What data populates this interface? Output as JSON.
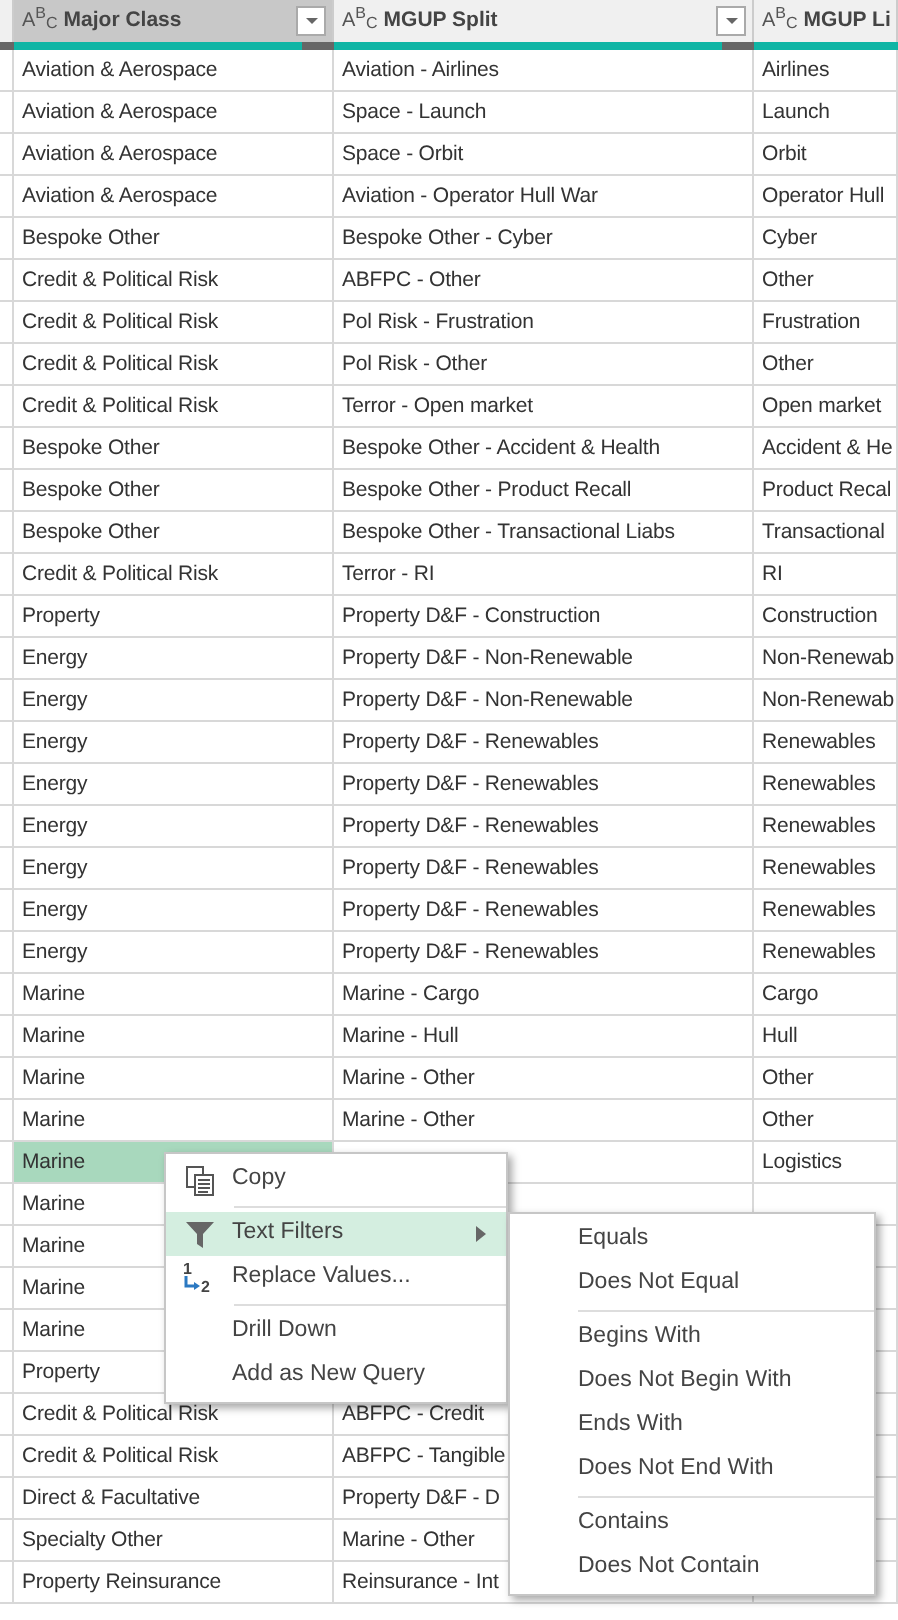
{
  "columns": [
    {
      "type_label": "A$^{B}$$_{C}$",
      "title": "Major Class",
      "selected": true,
      "filter_button": true
    },
    {
      "type_label": "A$^{B}$$_{C}$",
      "title": "MGUP Split",
      "selected": false,
      "filter_button": true
    },
    {
      "type_label": "A$^{B}$$_{C}$",
      "title": "MGUP Li",
      "selected": false,
      "filter_button": false
    }
  ],
  "rows": [
    {
      "selected": false,
      "cells": [
        "Aviation & Aerospace",
        "Aviation - Airlines",
        "Airlines"
      ]
    },
    {
      "selected": false,
      "cells": [
        "Aviation & Aerospace",
        "Space - Launch",
        "Launch"
      ]
    },
    {
      "selected": false,
      "cells": [
        "Aviation & Aerospace",
        "Space - Orbit",
        "Orbit"
      ]
    },
    {
      "selected": false,
      "cells": [
        "Aviation & Aerospace",
        "Aviation - Operator Hull War",
        "Operator Hull"
      ]
    },
    {
      "selected": false,
      "cells": [
        "Bespoke Other",
        "Bespoke Other - Cyber",
        "Cyber"
      ]
    },
    {
      "selected": false,
      "cells": [
        "Credit & Political Risk",
        "ABFPC - Other",
        "Other"
      ]
    },
    {
      "selected": false,
      "cells": [
        "Credit & Political Risk",
        "Pol Risk - Frustration",
        "Frustration"
      ]
    },
    {
      "selected": false,
      "cells": [
        "Credit & Political Risk",
        "Pol Risk - Other",
        "Other"
      ]
    },
    {
      "selected": false,
      "cells": [
        "Credit & Political Risk",
        "Terror - Open market",
        "Open market"
      ]
    },
    {
      "selected": false,
      "cells": [
        "Bespoke Other",
        "Bespoke Other - Accident & Health",
        "Accident & He"
      ]
    },
    {
      "selected": false,
      "cells": [
        "Bespoke Other",
        "Bespoke Other - Product Recall",
        "Product Recal"
      ]
    },
    {
      "selected": false,
      "cells": [
        "Bespoke Other",
        "Bespoke Other - Transactional Liabs",
        "Transactional"
      ]
    },
    {
      "selected": false,
      "cells": [
        "Credit & Political Risk",
        "Terror - RI",
        "RI"
      ]
    },
    {
      "selected": false,
      "cells": [
        "Property",
        "Property D&F - Construction",
        "Construction"
      ]
    },
    {
      "selected": false,
      "cells": [
        "Energy",
        "Property D&F - Non-Renewable",
        "Non-Renewab"
      ]
    },
    {
      "selected": false,
      "cells": [
        "Energy",
        "Property D&F - Non-Renewable",
        "Non-Renewab"
      ]
    },
    {
      "selected": false,
      "cells": [
        "Energy",
        "Property D&F - Renewables",
        "Renewables"
      ]
    },
    {
      "selected": false,
      "cells": [
        "Energy",
        "Property D&F - Renewables",
        "Renewables"
      ]
    },
    {
      "selected": false,
      "cells": [
        "Energy",
        "Property D&F - Renewables",
        "Renewables"
      ]
    },
    {
      "selected": false,
      "cells": [
        "Energy",
        "Property D&F - Renewables",
        "Renewables"
      ]
    },
    {
      "selected": false,
      "cells": [
        "Energy",
        "Property D&F - Renewables",
        "Renewables"
      ]
    },
    {
      "selected": false,
      "cells": [
        "Energy",
        "Property D&F - Renewables",
        "Renewables"
      ]
    },
    {
      "selected": false,
      "cells": [
        "Marine",
        "Marine - Cargo",
        "Cargo"
      ]
    },
    {
      "selected": false,
      "cells": [
        "Marine",
        "Marine - Hull",
        "Hull"
      ]
    },
    {
      "selected": false,
      "cells": [
        "Marine",
        "Marine - Other",
        "Other"
      ]
    },
    {
      "selected": false,
      "cells": [
        "Marine",
        "Marine - Other",
        "Other"
      ]
    },
    {
      "selected": true,
      "cells": [
        "Marine",
        "",
        "Logistics"
      ]
    },
    {
      "selected": false,
      "cells": [
        "Marine",
        "",
        ""
      ]
    },
    {
      "selected": false,
      "cells": [
        "Marine",
        "",
        ""
      ]
    },
    {
      "selected": false,
      "cells": [
        "Marine",
        "",
        ""
      ]
    },
    {
      "selected": false,
      "cells": [
        "Marine",
        "",
        ""
      ]
    },
    {
      "selected": false,
      "cells": [
        "Property",
        "",
        ""
      ]
    },
    {
      "selected": false,
      "cells": [
        "Credit & Political Risk",
        "ABFPC - Credit",
        ""
      ]
    },
    {
      "selected": false,
      "cells": [
        "Credit & Political Risk",
        "ABFPC - Tangible",
        ""
      ]
    },
    {
      "selected": false,
      "cells": [
        "Direct & Facultative",
        "Property D&F - D",
        ""
      ]
    },
    {
      "selected": false,
      "cells": [
        "Specialty Other",
        "Marine - Other",
        ""
      ]
    },
    {
      "selected": false,
      "cells": [
        "Property Reinsurance",
        "Reinsurance - Int",
        ""
      ]
    }
  ],
  "context_menu": {
    "groups": [
      [
        {
          "label": "Copy",
          "kind": "copy",
          "highlighted": false,
          "submenu": false
        }
      ],
      [
        {
          "label": "Text Filters",
          "kind": "filter",
          "highlighted": true,
          "submenu": true
        },
        {
          "label": "Replace Values...",
          "kind": "replace",
          "icon_text": "$^{1}$$_{2}$",
          "highlighted": false,
          "submenu": false
        }
      ],
      [
        {
          "label": "Drill Down",
          "kind": "plain",
          "highlighted": false,
          "submenu": false
        },
        {
          "label": "Add as New Query",
          "kind": "plain",
          "highlighted": false,
          "submenu": false
        }
      ]
    ]
  },
  "submenu": {
    "groups": [
      [
        "Equals",
        "Does Not Equal"
      ],
      [
        "Begins With",
        "Does Not Begin With",
        "Ends With",
        "Does Not End With"
      ],
      [
        "Contains",
        "Does Not Contain"
      ]
    ]
  }
}
